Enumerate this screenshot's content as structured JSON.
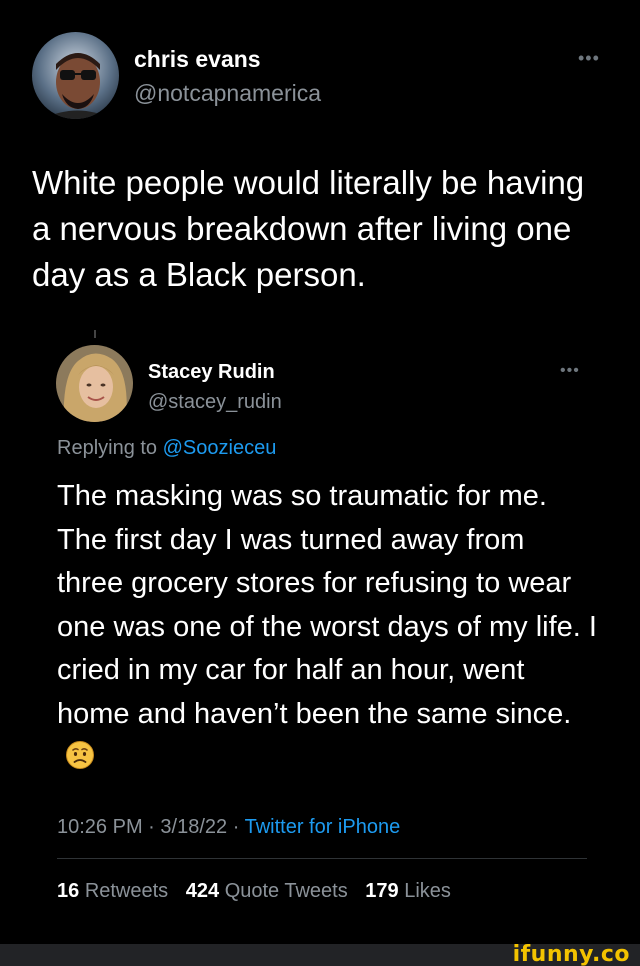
{
  "tweet": {
    "author_name": "chris evans",
    "author_handle": "@notcapnamerica",
    "more_icon": "more-horizontal-icon",
    "text": "White people would literally be having a nervous breakdown after living one day as a Black person."
  },
  "quoted_reply": {
    "author_name": "Stacey Rudin",
    "author_handle": "@stacey_rudin",
    "more_icon": "more-horizontal-icon",
    "replying_to_label": "Replying to",
    "replying_to_user": "@Soozieceu",
    "text": "The masking was so traumatic for me. The first day I was turned away from three grocery stores for refusing to wear one was one of the worst days of my life. I cried in my car for half an hour, went home and haven’t been the same since.",
    "emoji": "worried-face-emoji",
    "time": "10:26 PM",
    "date": "3/18/22",
    "separator": "·",
    "source": "Twitter for iPhone",
    "stats": {
      "retweets_count": "16",
      "retweets_label": "Retweets",
      "quotes_count": "424",
      "quotes_label": "Quote Tweets",
      "likes_count": "179",
      "likes_label": "Likes"
    }
  },
  "watermark": {
    "text": "ifunny.co",
    "color": "#f3c300"
  },
  "colors": {
    "background": "#000000",
    "link": "#1d9bf0",
    "secondary_text": "#8b9299"
  }
}
